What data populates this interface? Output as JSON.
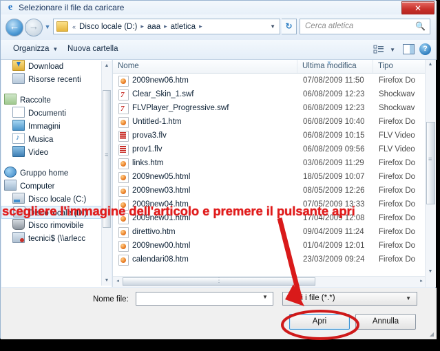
{
  "window": {
    "title": "Selezionare il file da caricare",
    "title_icon": "internet-explorer-icon",
    "close_label": "✕"
  },
  "nav": {
    "back_glyph": "←",
    "forward_glyph": "→",
    "history_glyph": "▼",
    "breadcrumb_prefix": "«",
    "breadcrumbs": [
      "Disco locale (D:)",
      "aaa",
      "atletica"
    ],
    "separator": "▸",
    "dropdown_glyph": "▼",
    "refresh_glyph": "↻"
  },
  "search": {
    "placeholder": "Cerca atletica",
    "icon": "search-icon"
  },
  "toolbar": {
    "organize_label": "Organizza",
    "organize_caret": "▼",
    "new_folder_label": "Nuova cartella",
    "view_caret": "▼",
    "help_label": "?"
  },
  "sidebar": {
    "items": [
      {
        "label": "Download",
        "icon": "download-folder-icon",
        "indent": 16,
        "selected": false
      },
      {
        "label": "Risorse recenti",
        "icon": "recent-places-icon",
        "indent": 16,
        "selected": false
      },
      {
        "label": "Raccolte",
        "icon": "libraries-icon",
        "indent": 4,
        "selected": false
      },
      {
        "label": "Documenti",
        "icon": "documents-icon",
        "indent": 16,
        "selected": false
      },
      {
        "label": "Immagini",
        "icon": "pictures-icon",
        "indent": 16,
        "selected": false
      },
      {
        "label": "Musica",
        "icon": "music-icon",
        "indent": 16,
        "selected": false
      },
      {
        "label": "Video",
        "icon": "video-icon",
        "indent": 16,
        "selected": false
      },
      {
        "label": "Gruppo home",
        "icon": "homegroup-icon",
        "indent": 4,
        "selected": false
      },
      {
        "label": "Computer",
        "icon": "computer-icon",
        "indent": 4,
        "selected": false
      },
      {
        "label": "Disco locale (C:)",
        "icon": "system-drive-icon",
        "indent": 16,
        "selected": false
      },
      {
        "label": "Disco locale (D:)",
        "icon": "drive-icon",
        "indent": 16,
        "selected": true
      },
      {
        "label": "Disco rimovibile",
        "icon": "removable-drive-icon",
        "indent": 16,
        "selected": false
      },
      {
        "label": "tecnici$ (\\\\arlecc",
        "icon": "network-drive-icon",
        "indent": 16,
        "selected": false
      }
    ],
    "scroll_up": "▲",
    "scroll_down": "▼"
  },
  "filelist": {
    "columns": [
      "Nome",
      "Ultima modifica",
      "Tipo"
    ],
    "sort_indicator": "▼",
    "rows": [
      {
        "name": "2009new06.htm",
        "date": "07/08/2009 11:50",
        "type": "Firefox Do",
        "icon": "htm"
      },
      {
        "name": "Clear_Skin_1.swf",
        "date": "06/08/2009 12:23",
        "type": "Shockwav",
        "icon": "swf"
      },
      {
        "name": "FLVPlayer_Progressive.swf",
        "date": "06/08/2009 12:23",
        "type": "Shockwav",
        "icon": "swf"
      },
      {
        "name": "Untitled-1.htm",
        "date": "06/08/2009 10:40",
        "type": "Firefox Do",
        "icon": "htm"
      },
      {
        "name": "prova3.flv",
        "date": "06/08/2009 10:15",
        "type": "FLV Video",
        "icon": "flv"
      },
      {
        "name": "prov1.flv",
        "date": "06/08/2009 09:56",
        "type": "FLV Video",
        "icon": "flv"
      },
      {
        "name": "links.htm",
        "date": "03/06/2009 11:29",
        "type": "Firefox Do",
        "icon": "htm"
      },
      {
        "name": "2009new05.html",
        "date": "18/05/2009 10:07",
        "type": "Firefox Do",
        "icon": "htm"
      },
      {
        "name": "2009new03.html",
        "date": "08/05/2009 12:26",
        "type": "Firefox Do",
        "icon": "htm"
      },
      {
        "name": "2009new04.htm",
        "date": "07/05/2009 13:33",
        "type": "Firefox Do",
        "icon": "htm"
      },
      {
        "name": "2009new01.html",
        "date": "17/04/2009 12:08",
        "type": "Firefox Do",
        "icon": "htm"
      },
      {
        "name": "direttivo.htm",
        "date": "09/04/2009 11:24",
        "type": "Firefox Do",
        "icon": "htm"
      },
      {
        "name": "2009new00.html",
        "date": "01/04/2009 12:01",
        "type": "Firefox Do",
        "icon": "htm"
      },
      {
        "name": "calendari08.htm",
        "date": "23/03/2009 09:24",
        "type": "Firefox Do",
        "icon": "htm"
      }
    ],
    "h_scroll_left": "◂",
    "h_scroll_right": "▸"
  },
  "footer": {
    "filename_label": "Nome file:",
    "filename_value": "",
    "filename_caret": "▼",
    "filter_value": "Tutti i file (*.*)",
    "filter_caret": "▼",
    "open_label": "Apri",
    "cancel_label": "Annulla",
    "grip": "◢"
  },
  "annotation": {
    "text": "scegliere l'immagine dell'articolo e premere il pulsante apri",
    "color": "#e01b1b",
    "arrow_name": "red-arrow-to-filter-dropdown",
    "ellipse_name": "red-ellipse-around-open-button"
  }
}
